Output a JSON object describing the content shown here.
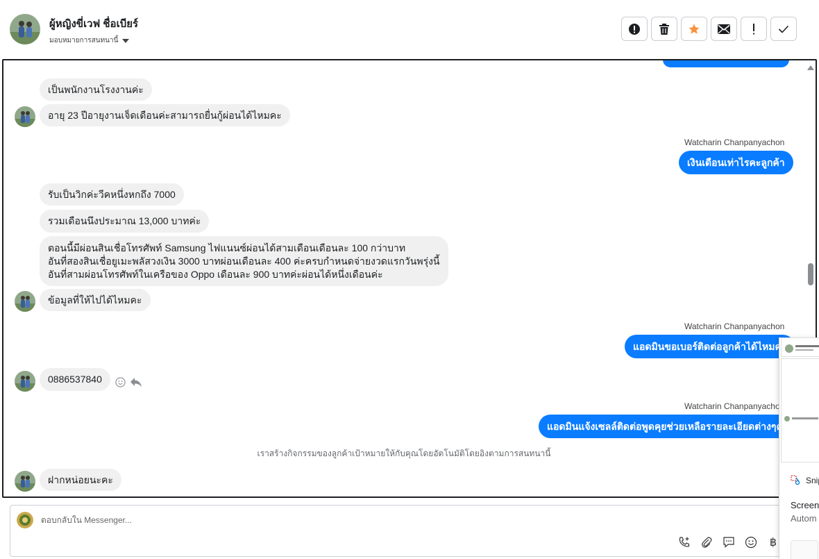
{
  "header": {
    "contact_name": "ผู้หญิงขี่เวฟ ชื่อเบียร์",
    "assign_label": "มอบหมายการสนทนานี้"
  },
  "messages": {
    "m1": "เป็นพนักงานโรงงานค่ะ",
    "m2": "อายุ 23 ปีอายุงานเจ็ดเดือนค่ะสามารถยื่นกู้ผ่อนได้ไหมคะ",
    "sender1": "Watcharin Chanpanyachon",
    "out1": "เงินเดือนเท่าไรคะลูกค้า",
    "m3": "รับเป็นวิกค่ะวีคหนึ่งหกถึง 7000",
    "m4": "รวมเดือนนึงประมาณ 13,000 บาทค่ะ",
    "m5_line1": "ตอนนี้มีผ่อนสินเชื่อโทรศัพท์ Samsung ไฟแนนซ์ผ่อนได้สามเดือนเดือนละ 100 กว่าบาท",
    "m5_line2": "อันที่สองสินเชื่อยูเมะพลัสวงเงิน 3000 บาทผ่อนเดือนละ 400 ค่ะครบกำหนดจ่ายงวดแรกวันพรุ่งนี้",
    "m5_line3": "อันที่สามผ่อนโทรศัพท์ในเครือของ Oppo เดือนละ 900 บาทค่ะผ่อนได้หนึ่งเดือนค่ะ",
    "m6": "ข้อมูลที่ให้ไปได้ไหมคะ",
    "sender2": "Watcharin Chanpanyachon",
    "out2": "แอดมินขอเบอร์ติดต่อลูกค้าได้ไหมคะ",
    "m7": "0886537840",
    "sender3": "Watcharin Chanpanyacho",
    "out3": "แอดมินแจ้งเซลล์ติดต่อพูดคุยช่วยเหลือรายละเอียดต่างๆค่ะ",
    "system_note": "เราสร้างกิจกรรมของลูกค้าเป้าหมายให้กับคุณโดยอัตโนมัติโดยอิงตามการสนทนานี้",
    "m8": "ฝากหน่อยนะคะ"
  },
  "composer": {
    "placeholder": "ตอบกลับใน Messenger..."
  },
  "overlay": {
    "snip_label": "Snip",
    "screen_label": "Screen",
    "auto_label": "Autom"
  },
  "icons": {
    "actions": [
      "alert-circle-icon",
      "trash-icon",
      "star-icon",
      "envelope-icon",
      "exclamation-icon",
      "check-icon"
    ],
    "composer_tools": [
      "phone-plus-icon",
      "paperclip-icon",
      "chat-bubble-icon",
      "emoji-icon",
      "baht-icon"
    ]
  },
  "colors": {
    "outgoing_bubble": "#0a7cff",
    "incoming_bubble": "#f0f0f0",
    "star": "#f7923b"
  }
}
